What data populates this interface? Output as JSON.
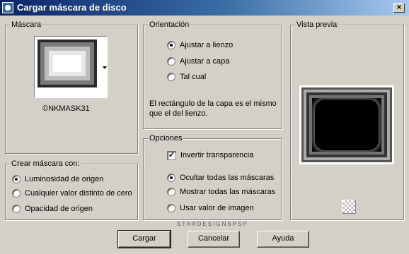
{
  "window": {
    "title": "Cargar máscara de disco",
    "close": "×"
  },
  "mask_group": {
    "legend": "Máscara",
    "mask_name": "©NKMASK31"
  },
  "create_group": {
    "legend": "Crear máscara con:",
    "options": [
      {
        "label": "Luminosidad de origen",
        "selected": true
      },
      {
        "label": "Cualquier valor distinto de cero",
        "selected": false
      },
      {
        "label": "Opacidad de origen",
        "selected": false
      }
    ]
  },
  "orientation_group": {
    "legend": "Orientación",
    "options": [
      {
        "label": "Ajustar a lienzo",
        "selected": true
      },
      {
        "label": "Ajustar a capa",
        "selected": false
      },
      {
        "label": "Tal cual",
        "selected": false
      }
    ],
    "note": "El rectángulo de la capa es el mismo que el del lienzo."
  },
  "options_group": {
    "legend": "Opciones",
    "invert": {
      "label": "Invertir transparencia",
      "checked": true,
      "mark": "✓"
    },
    "visibility": [
      {
        "label": "Ocultar todas las máscaras",
        "selected": true
      },
      {
        "label": "Mostrar todas las máscaras",
        "selected": false
      },
      {
        "label": "Usar valor de imagen",
        "selected": false
      }
    ]
  },
  "preview_group": {
    "legend": "Vista previa"
  },
  "buttons": {
    "load": "Cargar",
    "cancel": "Cancelar",
    "help": "Ayuda"
  },
  "watermark": "STARDESIGNSPSP"
}
